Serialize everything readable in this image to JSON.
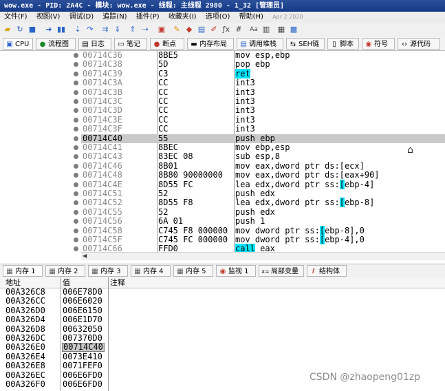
{
  "window": {
    "title": "wow.exe - PID: 2A4C - 模块: wow.exe - 线程: 主线程 2980 - 1_32 [管理员]"
  },
  "menu": {
    "items": [
      "文件(F)",
      "视图(V)",
      "调试(D)",
      "追踪(N)",
      "插件(P)",
      "收藏夹(I)",
      "选项(O)",
      "帮助(H)"
    ],
    "date": "Apr 2 2020"
  },
  "toolbar": {
    "icons": [
      "open-icon",
      "restart-icon",
      "stop-icon",
      "run-icon",
      "pause-icon",
      "step-into-icon",
      "step-over-icon",
      "step-over-alt-icon",
      "run-to-user-icon",
      "execute-till-return-icon",
      "animate-icon",
      "trace-icon",
      "breakpoint-icon",
      "patch-icon",
      "memory-icon",
      "script-icon",
      "comment-icon",
      "fx-icon",
      "hash-icon",
      "font-icon",
      "log-icon",
      "calculator-icon",
      "cpu-icon"
    ]
  },
  "top_tabs": [
    {
      "label": "CPU",
      "icon": "cpu-icon"
    },
    {
      "label": "流程图",
      "icon": "graph-icon"
    },
    {
      "label": "日志",
      "icon": "log-icon"
    },
    {
      "label": "笔记",
      "icon": "notes-icon"
    },
    {
      "label": "断点",
      "icon": "breakpoint-icon"
    },
    {
      "label": "内存布局",
      "icon": "memory-map-icon"
    },
    {
      "label": "调用堆栈",
      "icon": "call-stack-icon"
    },
    {
      "label": "SEH链",
      "icon": "seh-icon"
    },
    {
      "label": "脚本",
      "icon": "script-icon"
    },
    {
      "label": "符号",
      "icon": "symbols-icon"
    },
    {
      "label": "源代码",
      "icon": "source-icon"
    }
  ],
  "disassembly": [
    {
      "addr": "00714C36",
      "bytes": "8BE5",
      "parts": [
        {
          "t": "mov esp,ebp"
        }
      ]
    },
    {
      "addr": "00714C38",
      "bytes": "5D",
      "parts": [
        {
          "t": "pop ebp"
        }
      ]
    },
    {
      "addr": "00714C39",
      "bytes": "C3",
      "parts": [
        {
          "t": "ret",
          "hl": true
        }
      ]
    },
    {
      "addr": "00714C3A",
      "bytes": "CC",
      "parts": [
        {
          "t": "int3"
        }
      ]
    },
    {
      "addr": "00714C3B",
      "bytes": "CC",
      "parts": [
        {
          "t": "int3"
        }
      ]
    },
    {
      "addr": "00714C3C",
      "bytes": "CC",
      "parts": [
        {
          "t": "int3"
        }
      ]
    },
    {
      "addr": "00714C3D",
      "bytes": "CC",
      "parts": [
        {
          "t": "int3"
        }
      ]
    },
    {
      "addr": "00714C3E",
      "bytes": "CC",
      "parts": [
        {
          "t": "int3"
        }
      ]
    },
    {
      "addr": "00714C3F",
      "bytes": "CC",
      "parts": [
        {
          "t": "int3"
        }
      ]
    },
    {
      "addr": "00714C40",
      "bytes": "55",
      "parts": [
        {
          "t": "push ebp"
        }
      ],
      "selected": true
    },
    {
      "addr": "00714C41",
      "bytes": "8BEC",
      "parts": [
        {
          "t": "mov ebp,esp"
        }
      ]
    },
    {
      "addr": "00714C43",
      "bytes": "83EC 08",
      "parts": [
        {
          "t": "sub esp,8"
        }
      ]
    },
    {
      "addr": "00714C46",
      "bytes": "8B01",
      "parts": [
        {
          "t": "mov eax,dword ptr ds:[ecx]"
        }
      ]
    },
    {
      "addr": "00714C48",
      "bytes": "8B80 90000000",
      "parts": [
        {
          "t": "mov eax,dword ptr ds:[eax+90]"
        }
      ]
    },
    {
      "addr": "00714C4E",
      "bytes": "8D55 FC",
      "parts": [
        {
          "t": "lea edx,dword ptr ss:"
        },
        {
          "t": "[",
          "hl": true
        },
        {
          "t": "ebp-4]"
        }
      ]
    },
    {
      "addr": "00714C51",
      "bytes": "52",
      "parts": [
        {
          "t": "push edx"
        }
      ]
    },
    {
      "addr": "00714C52",
      "bytes": "8D55 F8",
      "parts": [
        {
          "t": "lea edx,dword ptr ss:"
        },
        {
          "t": "[",
          "hl": true
        },
        {
          "t": "ebp-8]"
        }
      ]
    },
    {
      "addr": "00714C55",
      "bytes": "52",
      "parts": [
        {
          "t": "push edx"
        }
      ]
    },
    {
      "addr": "00714C56",
      "bytes": "6A 01",
      "parts": [
        {
          "t": "push 1"
        }
      ]
    },
    {
      "addr": "00714C58",
      "bytes": "C745 F8 000000",
      "parts": [
        {
          "t": "mov dword ptr ss:"
        },
        {
          "t": "[",
          "hl": true
        },
        {
          "t": "ebp-8],0"
        }
      ]
    },
    {
      "addr": "00714C5F",
      "bytes": "C745 FC 000000",
      "parts": [
        {
          "t": "mov dword ptr ss:"
        },
        {
          "t": "[",
          "hl": true
        },
        {
          "t": "ebp-4],0"
        }
      ]
    },
    {
      "addr": "00714C66",
      "bytes": "FFD0",
      "parts": [
        {
          "t": "call",
          "hl": true
        },
        {
          "t": " eax"
        }
      ]
    }
  ],
  "bottom_tabs": [
    {
      "label": "内存 1",
      "icon": "memory-icon"
    },
    {
      "label": "内存 2",
      "icon": "memory-icon"
    },
    {
      "label": "内存 3",
      "icon": "memory-icon"
    },
    {
      "label": "内存 4",
      "icon": "memory-icon"
    },
    {
      "label": "内存 5",
      "icon": "memory-icon"
    },
    {
      "label": "监视 1",
      "icon": "watch-icon"
    },
    {
      "label": "局部变量",
      "icon": "locals-icon"
    },
    {
      "label": "结构体",
      "icon": "struct-icon"
    }
  ],
  "memory": {
    "headers": {
      "addr": "地址",
      "value": "值",
      "comment": "注释"
    },
    "rows": [
      {
        "addr": "00A326C8",
        "value": "006E78D0"
      },
      {
        "addr": "00A326CC",
        "value": "006E6020"
      },
      {
        "addr": "00A326D0",
        "value": "006E6150"
      },
      {
        "addr": "00A326D4",
        "value": "006E1D70"
      },
      {
        "addr": "00A326D8",
        "value": "00632050"
      },
      {
        "addr": "00A326DC",
        "value": "007370D0"
      },
      {
        "addr": "00A326E0",
        "value": "00714C40",
        "selected": true
      },
      {
        "addr": "00A326E4",
        "value": "0073E410"
      },
      {
        "addr": "00A326E8",
        "value": "0071FEF0"
      },
      {
        "addr": "00A326EC",
        "value": "006E6FD0"
      },
      {
        "addr": "00A326F0",
        "value": "006E6FD0"
      }
    ]
  },
  "watermark": "CSDN @zhaopeng01zp"
}
